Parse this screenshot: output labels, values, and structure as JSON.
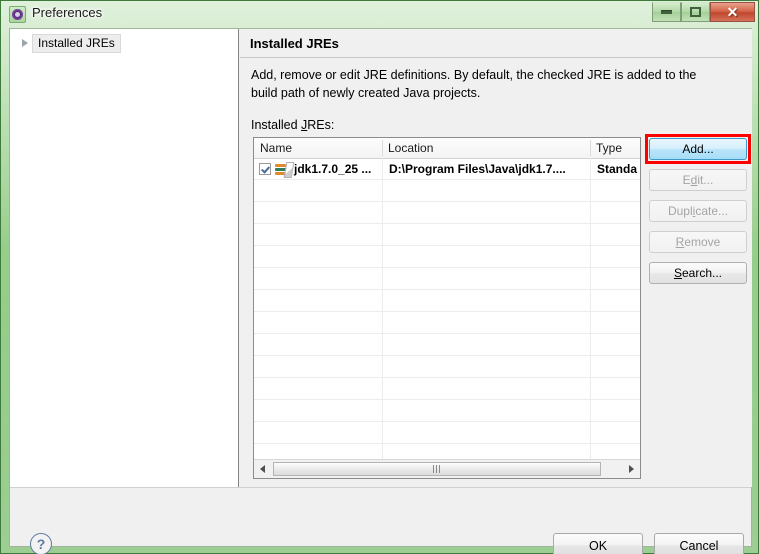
{
  "window": {
    "title": "Preferences",
    "icon": "preferences-gear-icon",
    "controls": {
      "minimize": "Minimize",
      "maximize": "Restore",
      "close": "Close",
      "close_glyph": "✕"
    },
    "frame_color": "#8ac77d"
  },
  "sidebar": {
    "items": [
      {
        "label": "Installed JREs",
        "expanded": false,
        "selected": true,
        "arrow": "chevron-right-icon"
      }
    ]
  },
  "content": {
    "page_title": "Installed JREs",
    "description": "Add, remove or edit JRE definitions. By default, the checked JRE is added to the build path of newly created Java projects.",
    "table_label": "Installed JREs:",
    "table": {
      "columns": [
        "Name",
        "Location",
        "Type"
      ],
      "rows": [
        {
          "checked": true,
          "icon": "jre-library-icon",
          "name": "jdk1.7.0_25 ...",
          "location": "D:\\Program Files\\Java\\jdk1.7....",
          "type": "Standa"
        }
      ],
      "empty_row_count": 13,
      "scrollbar": {
        "left_arrow": "arrow-left-icon",
        "right_arrow": "arrow-right-icon",
        "grip": "grip-icon"
      }
    },
    "buttons": [
      {
        "id": "add",
        "label": "Add...",
        "enabled": true,
        "highlighted": true,
        "state": "hover"
      },
      {
        "id": "edit",
        "label": "Edit...",
        "enabled": false,
        "highlighted": false,
        "accel": "E"
      },
      {
        "id": "duplicate",
        "label": "Duplicate...",
        "enabled": false,
        "highlighted": false,
        "accel": "i"
      },
      {
        "id": "remove",
        "label": "Remove",
        "enabled": false,
        "highlighted": false,
        "accel": "R"
      },
      {
        "id": "search",
        "label": "Search...",
        "enabled": true,
        "highlighted": false,
        "accel": "S"
      }
    ],
    "highlight_color": "#ff0000"
  },
  "footer": {
    "help_icon": "?",
    "ok_label": "OK",
    "cancel_label": "Cancel"
  }
}
